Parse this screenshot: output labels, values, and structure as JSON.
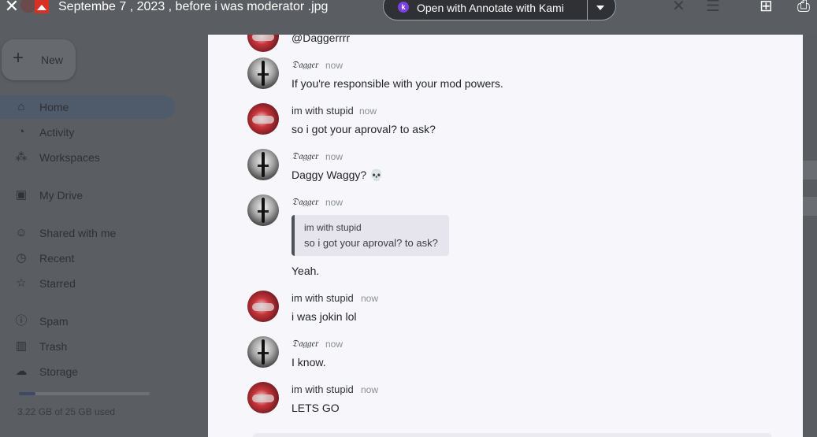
{
  "viewer": {
    "file_title": "Septembe 7 , 2023 , before i was moderator .jpg",
    "open_with_label": "Open with Annotate with Kami",
    "kami_letter": "k"
  },
  "drive": {
    "new_label": "New",
    "nav": [
      {
        "label": "Home",
        "icon": "home-icon"
      },
      {
        "label": "Activity",
        "icon": "bell-icon"
      },
      {
        "label": "Workspaces",
        "icon": "workspaces-icon"
      },
      {
        "label": "My Drive",
        "icon": "drive-icon"
      },
      {
        "label": "Shared with me",
        "icon": "people-icon"
      },
      {
        "label": "Recent",
        "icon": "clock-icon"
      },
      {
        "label": "Starred",
        "icon": "star-icon"
      },
      {
        "label": "Spam",
        "icon": "spam-icon"
      },
      {
        "label": "Trash",
        "icon": "trash-icon"
      },
      {
        "label": "Storage",
        "icon": "cloud-icon"
      }
    ],
    "storage_text": "3.22 GB of 25 GB used",
    "storage_fraction": 0.129
  },
  "chat": {
    "top_mention": "@Daggerrrr",
    "messages": [
      {
        "user": "𝔇𝔞𝔤𝔤𝔢𝔯",
        "time": "now",
        "text": "If you're responsible with your mod powers."
      },
      {
        "user": "im with stupid",
        "time": "now",
        "text": "so i got your aproval? to ask?"
      },
      {
        "user": "𝔇𝔞𝔤𝔤𝔢𝔯",
        "time": "now",
        "text": "Daggy Waggy? 💀"
      },
      {
        "user": "𝔇𝔞𝔤𝔤𝔢𝔯",
        "time": "now",
        "reply_user": "im with stupid",
        "reply_text": "so i got your aproval? to ask?",
        "text": "Yeah."
      },
      {
        "user": "im with stupid",
        "time": "now",
        "text": "i was jokin lol"
      },
      {
        "user": "𝔇𝔞𝔤𝔤𝔢𝔯",
        "time": "now",
        "text": "I know."
      },
      {
        "user": "im with stupid",
        "time": "now",
        "text": "LETS GO"
      }
    ]
  }
}
